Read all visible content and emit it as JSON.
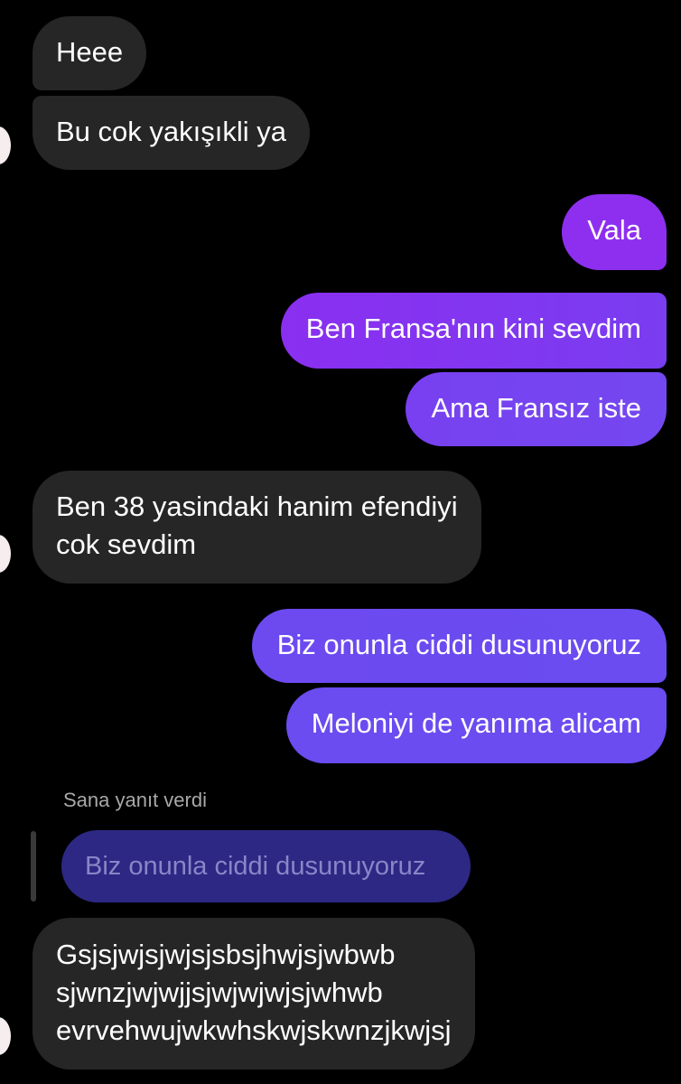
{
  "colors": {
    "background": "#000000",
    "incoming_bubble": "#262626",
    "outgoing_purple": "#8e2ff0",
    "outgoing_violet": "#6a4cf0",
    "reply_quote": "#2c2883"
  },
  "messages": [
    {
      "id": "m1",
      "direction": "incoming",
      "text": "Heee"
    },
    {
      "id": "m2",
      "direction": "incoming",
      "text": "Bu cok yakışıkli ya"
    },
    {
      "id": "m3",
      "direction": "outgoing",
      "text": "Vala"
    },
    {
      "id": "m4",
      "direction": "outgoing",
      "text": "Ben Fransa'nın kini sevdim"
    },
    {
      "id": "m5",
      "direction": "outgoing",
      "text": "Ama Fransız iste"
    },
    {
      "id": "m6",
      "direction": "incoming",
      "text": "Ben 38 yasindaki hanim efendiyi\ncok sevdim"
    },
    {
      "id": "m7",
      "direction": "outgoing",
      "text": "Biz onunla ciddi dusunuyoruz"
    },
    {
      "id": "m8",
      "direction": "outgoing",
      "text": "Meloniyi de yanıma alicam"
    },
    {
      "id": "m9",
      "direction": "incoming",
      "text": "Gsjsjwjsjwjsjsbsjhwjsjwbwb\nsjwnzjwjwjjsjwjwjwjsjwhwb\nevrvehwujwkwhskwjskwnzjkwjsj"
    }
  ],
  "reply_context": {
    "label": "Sana yanıt verdi",
    "quoted_text": "Biz onunla ciddi dusunuyoruz"
  }
}
